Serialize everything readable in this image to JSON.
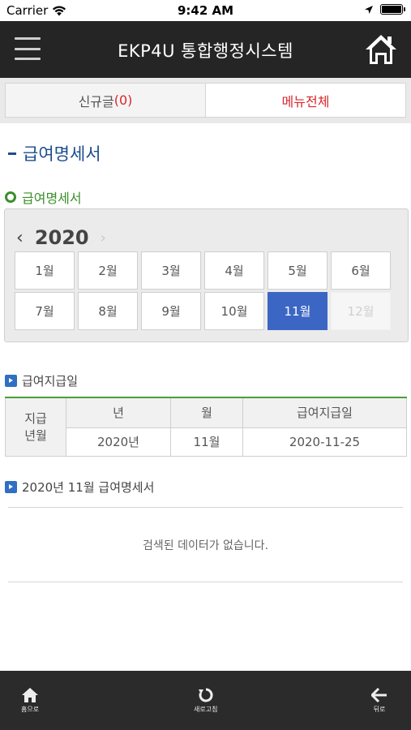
{
  "status_bar": {
    "carrier": "Carrier",
    "time": "9:42 AM"
  },
  "header": {
    "title": "EKP4U 통합행정시스템"
  },
  "tabs": {
    "new_label": "신규글",
    "new_count": "(0)",
    "all_label": "메뉴전체"
  },
  "page_title": "급여명세서",
  "calendar": {
    "section_title": "급여명세서",
    "prev": "‹",
    "next": "›",
    "year": "2020",
    "months": [
      "1월",
      "2월",
      "3월",
      "4월",
      "5월",
      "6월",
      "7월",
      "8월",
      "9월",
      "10월",
      "11월",
      "12월"
    ],
    "selected_month": "11월",
    "disabled_month": "12월"
  },
  "payday": {
    "section_title": "급여지급일",
    "row_header": "지급\n년월",
    "columns": [
      "년",
      "월",
      "급여지급일"
    ],
    "values": [
      "2020년",
      "11월",
      "2020-11-25"
    ]
  },
  "statement": {
    "section_title": "2020년 11월 급여명세서",
    "empty_message": "검색된 데이터가 없습니다."
  },
  "bottom_nav": {
    "home": "홈으로",
    "refresh": "새로고침",
    "back": "뒤로"
  },
  "colors": {
    "header_bg": "#252525",
    "accent_red": "#d9262c",
    "accent_blue": "#3b66c4",
    "accent_green": "#3a8f2a",
    "title_blue": "#1b4d8c"
  }
}
